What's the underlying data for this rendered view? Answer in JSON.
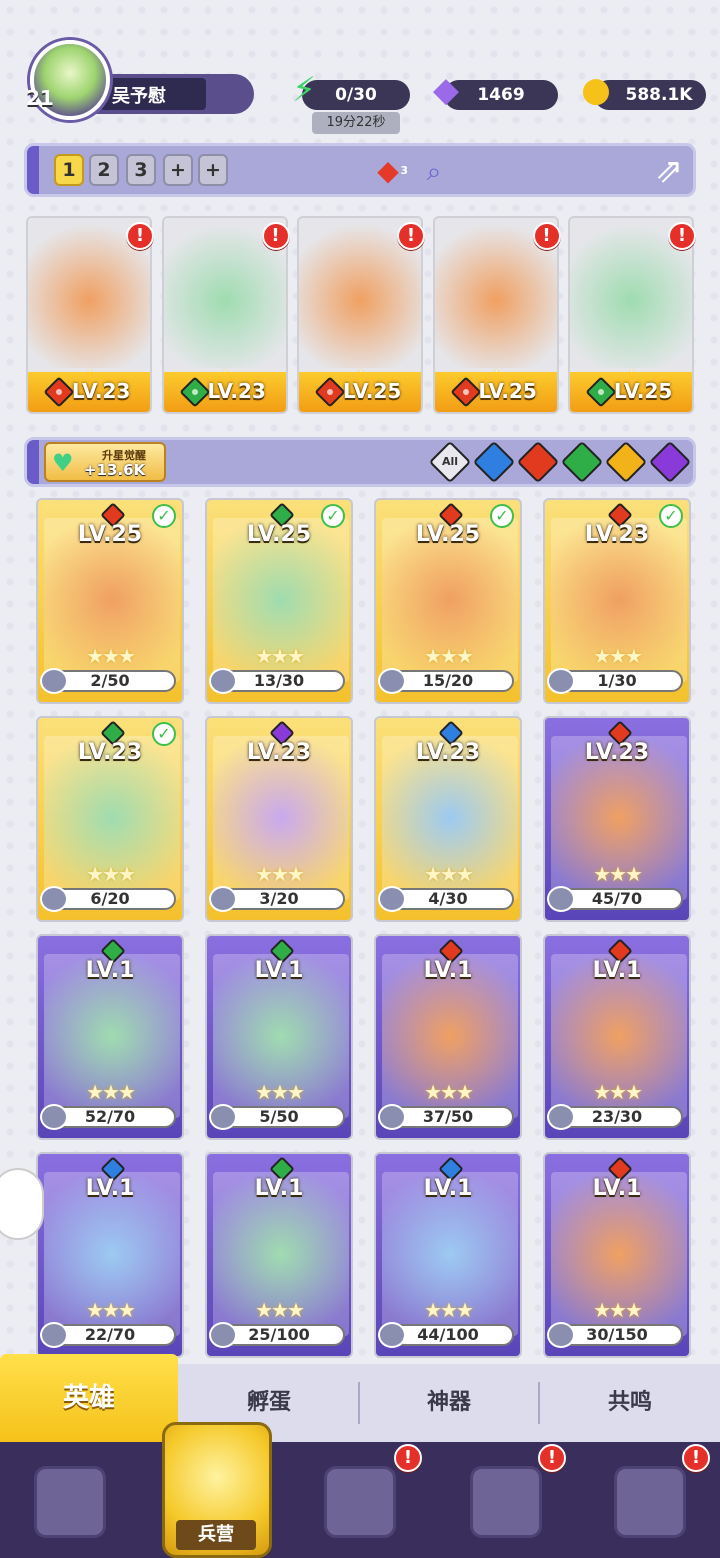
{
  "player": {
    "level": "21",
    "name": "吴予慰"
  },
  "resources": {
    "energy": "0/30",
    "energy_timer": "19分22秒",
    "gems": "1469",
    "gold": "588.1K"
  },
  "teams": {
    "tabs": [
      "1",
      "2",
      "3",
      "+",
      "+"
    ],
    "active": "1",
    "gem_count": "3"
  },
  "team_heroes": [
    {
      "element": "fire",
      "level": "LV.23"
    },
    {
      "element": "grass",
      "level": "LV.23"
    },
    {
      "element": "fire",
      "level": "LV.25"
    },
    {
      "element": "fire",
      "level": "LV.25"
    },
    {
      "element": "grass",
      "level": "LV.25"
    }
  ],
  "awaken": {
    "title": "升星觉醒",
    "value": "+13.6K"
  },
  "filters": {
    "all_label": "All",
    "elements": [
      "water",
      "fire",
      "grass",
      "light",
      "dark"
    ]
  },
  "heroes": [
    {
      "element": "fire",
      "level": "LV.25",
      "progress": "2/50",
      "checked": true,
      "frame": "gold"
    },
    {
      "element": "grass",
      "level": "LV.25",
      "progress": "13/30",
      "checked": true,
      "frame": "gold"
    },
    {
      "element": "fire",
      "level": "LV.25",
      "progress": "15/20",
      "checked": true,
      "frame": "gold"
    },
    {
      "element": "fire",
      "level": "LV.23",
      "progress": "1/30",
      "checked": true,
      "frame": "gold"
    },
    {
      "element": "grass",
      "level": "LV.23",
      "progress": "6/20",
      "checked": true,
      "frame": "gold"
    },
    {
      "element": "dark",
      "level": "LV.23",
      "progress": "3/20",
      "checked": false,
      "frame": "gold"
    },
    {
      "element": "water",
      "level": "LV.23",
      "progress": "4/30",
      "checked": false,
      "frame": "gold"
    },
    {
      "element": "fire",
      "level": "LV.23",
      "progress": "45/70",
      "checked": false,
      "frame": "purple"
    },
    {
      "element": "grass",
      "level": "LV.1",
      "progress": "52/70",
      "checked": false,
      "frame": "purple"
    },
    {
      "element": "grass",
      "level": "LV.1",
      "progress": "5/50",
      "checked": false,
      "frame": "purple"
    },
    {
      "element": "fire",
      "level": "LV.1",
      "progress": "37/50",
      "checked": false,
      "frame": "purple"
    },
    {
      "element": "fire",
      "level": "LV.1",
      "progress": "23/30",
      "checked": false,
      "frame": "purple"
    },
    {
      "element": "water",
      "level": "LV.1",
      "progress": "22/70",
      "checked": false,
      "frame": "purple"
    },
    {
      "element": "grass",
      "level": "LV.1",
      "progress": "25/100",
      "checked": false,
      "frame": "purple"
    },
    {
      "element": "water",
      "level": "LV.1",
      "progress": "44/100",
      "checked": false,
      "frame": "purple"
    },
    {
      "element": "fire",
      "level": "LV.1",
      "progress": "30/150",
      "checked": false,
      "frame": "purple"
    }
  ],
  "tabs": [
    "英雄",
    "孵蛋",
    "神器",
    "共鸣"
  ],
  "nav": {
    "active_label": "兵营"
  },
  "colors": {
    "accent": "#f5c21a",
    "nav_bg": "#3a2f5c",
    "bar_bg": "#a9a8d8"
  }
}
